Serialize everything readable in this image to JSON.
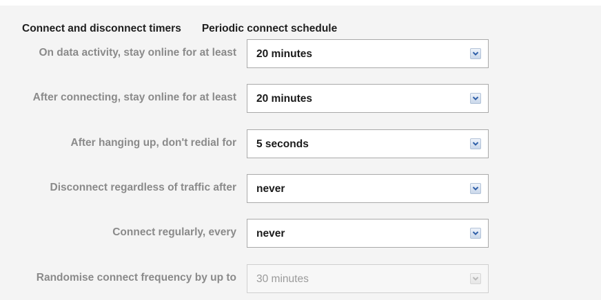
{
  "tabs": [
    {
      "label": "Connect and disconnect timers"
    },
    {
      "label": "Periodic connect schedule"
    }
  ],
  "rows": [
    {
      "label": "On data activity, stay online for at least",
      "value": "20 minutes",
      "enabled": true
    },
    {
      "label": "After connecting, stay online for at least",
      "value": "20 minutes",
      "enabled": true
    },
    {
      "label": "After hanging up, don't redial for",
      "value": "5 seconds",
      "enabled": true
    },
    {
      "label": "Disconnect regardless of traffic after",
      "value": "never",
      "enabled": true
    },
    {
      "label": "Connect regularly, every",
      "value": "never",
      "enabled": true
    },
    {
      "label": "Randomise connect frequency by up to",
      "value": "30 minutes",
      "enabled": false
    }
  ],
  "icons": {
    "dropdown": "chevron-down-icon"
  },
  "colors": {
    "panel_bg": "#f4f4f4",
    "label_text": "#8a8a8a",
    "value_text": "#1a1a1a",
    "dropdown_button": "#c9d7ea",
    "dropdown_arrow": "#2f5fa8",
    "disabled_text": "#9a9a9a"
  }
}
